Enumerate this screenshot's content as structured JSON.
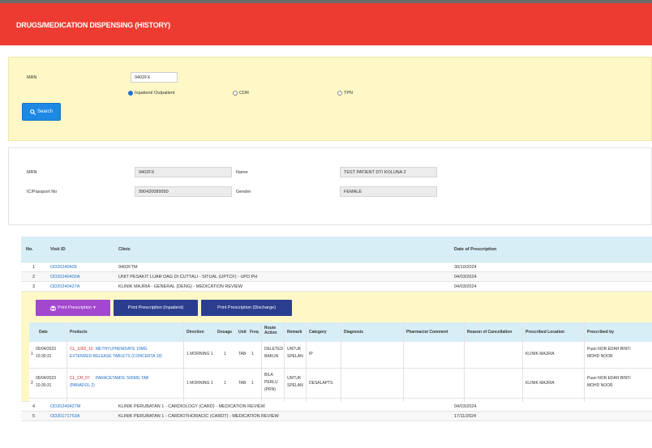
{
  "colors": {
    "header": "#ee3b31",
    "search_bg": "#fdf8c6",
    "table_head": "#d8eef7",
    "link": "#1f6fc6",
    "print_purple": "#a347cf",
    "print_navy": "#2b3d8f"
  },
  "page": {
    "title": "DRUGS/MEDICATION DISPENSING (HISTORY)"
  },
  "search": {
    "label": "MRN",
    "value": "9402FX",
    "radios": [
      {
        "label": "Inpatient/ Outpatient",
        "selected": true
      },
      {
        "label": "CDR",
        "selected": false
      },
      {
        "label": "TPN",
        "selected": false
      }
    ],
    "button_label": "Search",
    "button_icon": "search-icon"
  },
  "patient": {
    "mrn_label": "MRN",
    "mrn_value": "9402FX",
    "name_label": "Name",
    "name_value": "TEST PATIENT DTI KOLUNA 2",
    "ic_label": "IC/Passport No",
    "ic_value": "990420089950",
    "gender_label": "Gender",
    "gender_value": "FEMALE"
  },
  "history": {
    "columns": [
      "No.",
      "Visit ID",
      "Clinic",
      "Date of Prescription"
    ],
    "rows_top": [
      {
        "no": "1",
        "visit_id": "OD20240409",
        "clinic": "9402FTM",
        "date": "30/10/2024"
      },
      {
        "no": "2",
        "visit_id": "OD20240402A",
        "clinic": "UNIT PESAKIT LUAR DAG DI CUTTALI - SITUAL (UPTCF) - UPD PH",
        "date": "04/03/2024"
      },
      {
        "no": "3",
        "visit_id": "OD20240427A",
        "clinic": "KLINIK MAJRIA - GENERAL (DENG) - MEDICATION REVIEW",
        "date": "04/03/2024"
      }
    ],
    "rows_bottom": [
      {
        "no": "4",
        "visit_id": "OD20240427M",
        "clinic": "KLINIK PERUBATAN 1 - CARDIOLOGY (CARD) - MEDICATION REVIEW",
        "date": "04/03/2024"
      },
      {
        "no": "5",
        "visit_id": "OD20171753A",
        "clinic": "KLINIK PERUBATAN 1 - CARDIOTHORACIC (CARDT) - MEDICATION REVIEW",
        "date": "17/11/2024"
      }
    ]
  },
  "print_buttons": {
    "prescription": "Print Prescription",
    "inpatient": "Print Prescription (Inpatient)",
    "discharge": "Print Prescription (Discharge)"
  },
  "detail": {
    "columns": [
      "Date",
      "Products",
      "Direction",
      "Dosage",
      "Unit",
      "Freq",
      "Route Action",
      "Remark",
      "Category",
      "Diagnosis",
      "Pharmacist Comment",
      "Reason of Cancellation",
      "Prescribed Location",
      "Prescribed by"
    ],
    "rows": [
      {
        "no": "1",
        "date_1": "05/04/2023",
        "date_2": "10:30:31",
        "tag": "CL_1002_10",
        "product_1": "METHYLPHENIDATE 10MG",
        "product_2": "EXTENDED RELEASE TABLETS (CONCERTA 18)",
        "direction": "1 MORNING 1",
        "dosage": "1",
        "unit": "TAB",
        "freq": "1",
        "route_1": "DELETED",
        "route_2": "BAKUN",
        "remark_1": "UNTUK",
        "remark_2": "SPELAN",
        "category": "IP",
        "location": "KLINIK MAJRIA",
        "prescriber_1": "Puan NOR EDAH BINTI",
        "prescriber_2": "MOHD NOOR"
      },
      {
        "no": "2",
        "date_1": "05/04/2023",
        "date_2": "10:30:31",
        "tag": "CL_CH_07",
        "product_1": "PARACETAMOL 500MG TAB",
        "product_2": "(PANADOL 2)",
        "direction": "1 MORNING 1",
        "dosage": "1",
        "unit": "TAB",
        "freq": "1",
        "route_1": "BILA",
        "route_2": "PERLU",
        "route_3": "(PRN)",
        "remark_1": "UNTUK",
        "remark_2": "SPELAN",
        "category": "DESALAPTS",
        "location": "KLINIK MAJRIA",
        "prescriber_1": "Puan NOR EDAH BINTI",
        "prescriber_2": "MOHD NOOR"
      }
    ]
  }
}
